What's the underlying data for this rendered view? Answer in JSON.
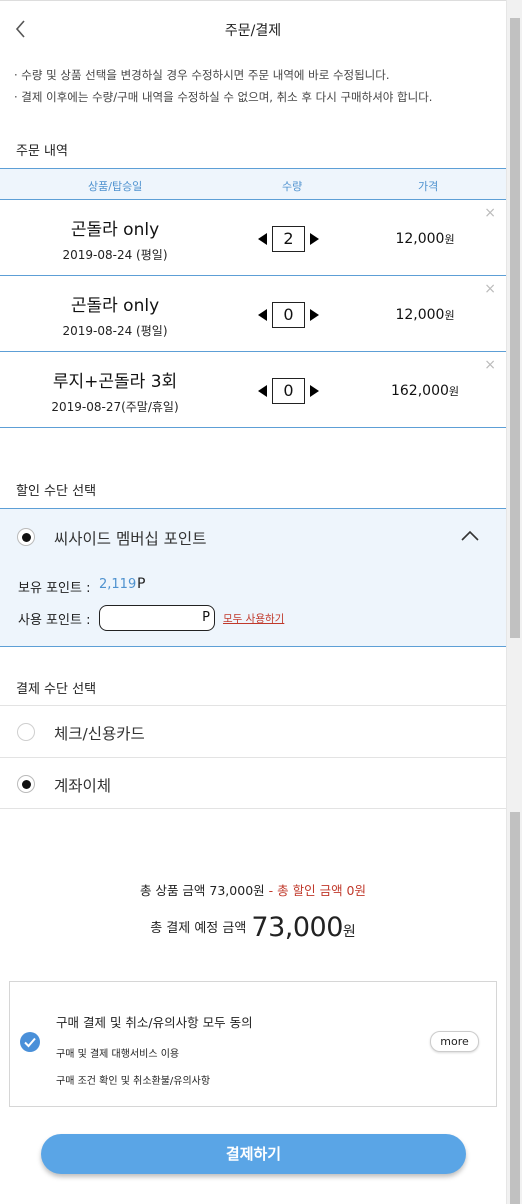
{
  "header": {
    "title": "주문/결제"
  },
  "notice": [
    "· 수량 및 상품 선택을 변경하실 경우 수정하시면 주문 내역에 바로 수정됩니다.",
    "· 결제 이후에는 수량/구매 내역을 수정하실 수 없으며, 취소 후 다시 구매하셔야 합니다."
  ],
  "order": {
    "title": "주문 내역",
    "columns": {
      "product": "상품/탑승일",
      "qty": "수량",
      "price": "가격"
    },
    "rows": [
      {
        "name": "곤돌라 only",
        "date": "2019-08-24 (평일)",
        "qty": "2",
        "price": "12,000",
        "unit": "원",
        "remove": "×"
      },
      {
        "name": "곤돌라 only",
        "date": "2019-08-24 (평일)",
        "qty": "0",
        "price": "12,000",
        "unit": "원",
        "remove": "×"
      },
      {
        "name": "루지+곤돌라 3회",
        "date": "2019-08-27(주말/휴일)",
        "qty": "0",
        "price": "162,000",
        "unit": "원",
        "remove": "×"
      }
    ]
  },
  "discount": {
    "title": "할인 수단 선택",
    "option": "씨사이드 멤버십 포인트",
    "owned_label": "보유 포인트 :",
    "owned_value": "2,119",
    "owned_unit": "P",
    "use_label": "사용 포인트 :",
    "use_value": "",
    "use_unit": "P",
    "use_all": "모두 사용하기"
  },
  "payment": {
    "title": "결제 수단 선택",
    "options": [
      {
        "label": "체크/신용카드",
        "selected": false
      },
      {
        "label": "계좌이체",
        "selected": true
      }
    ]
  },
  "summary": {
    "goods": "총 상품 금액 73,000원",
    "dash": " - ",
    "discount": "총 할인 금액 0원",
    "total_label": "총 결제 예정 금액",
    "total_amount": "73,000",
    "total_unit": "원"
  },
  "agree": {
    "title": "구매 결제 및 취소/유의사항 모두 동의",
    "items": [
      "구매 및 결제 대행서비스 이용",
      "구매 조건 확인 및 취소환불/유의사항"
    ],
    "more": "more"
  },
  "pay_button": "결제하기",
  "colors": {
    "accent": "#5aa5e6",
    "table_line": "#5d9fd6",
    "panel_bg": "#eef5fc",
    "warn": "#c0392b"
  }
}
